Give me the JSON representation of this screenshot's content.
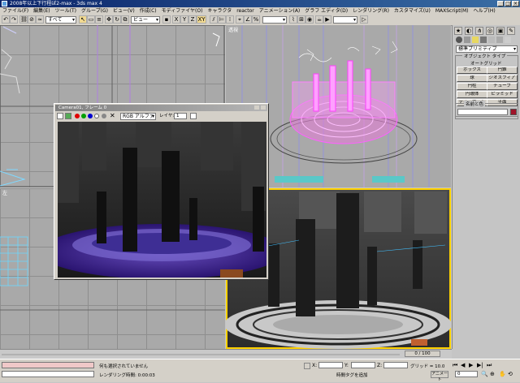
{
  "title_bar": {
    "title": "2008年以上下行程ぼ2-max - 3ds max 4",
    "min": "_",
    "max": "□",
    "close": "×"
  },
  "menu": [
    "ファイル(F)",
    "編集(E)",
    "ツール(T)",
    "グループ(G)",
    "ビュー(V)",
    "作成(C)",
    "モディファイヤ(O)",
    "キャラクタ",
    "reactor",
    "アニメーション(A)",
    "グラフ エディタ(D)",
    "レンダリング(R)",
    "カスタマイズ(U)",
    "MAXScript(M)",
    "ヘルプ(H)"
  ],
  "toolbar": {
    "selection_filter": "すべて",
    "ref_coord": "ビュー",
    "axis_x": "X",
    "axis_y": "Y",
    "axis_z": "Z",
    "axis_xy": "XY",
    "named_sel": ""
  },
  "viewports": {
    "top_right_label": "透視",
    "bottom_left_label": "左"
  },
  "float_window": {
    "title": "Camera01, フレーム 0",
    "channel": "RGB アルファ",
    "layer_label": "レイヤ:",
    "layer_value": "1"
  },
  "command_panel": {
    "category": "標準プリミティブ",
    "rollout_object_type": "オブジェクト タイプ",
    "autogrid": "オートグリッド",
    "buttons": [
      "ボックス",
      "円錐",
      "球",
      "ジオスフィア",
      "円柱",
      "チューブ",
      "円環体",
      "ピラミッド",
      "ティーポット",
      "平面"
    ],
    "rollout_name_color": "名前と色",
    "name_value": "",
    "color_swatch": "#a0142a"
  },
  "time_slider": {
    "frame": "0 / 100"
  },
  "status_bar": {
    "selection_text": "",
    "prompt_line1": "何も選択されていません",
    "prompt_line2": "レンダリング時間: 0:00:03",
    "coord_x_label": "X:",
    "coord_y_label": "Y:",
    "coord_z_label": "Z:",
    "coord_x": "",
    "coord_y": "",
    "coord_z": "",
    "grid_label": "グリッド = 10.0",
    "time_tag_hint": "時間タグを追加",
    "auto_key": "アニメート",
    "frame_value": "0"
  },
  "colors": {
    "accent": "#0a246a",
    "viewport_grid": "#a9a9a9",
    "active_viewport_border": "#ffd200",
    "magic_circle": "#c040c0",
    "floor_purple": "#3a1e8c"
  }
}
